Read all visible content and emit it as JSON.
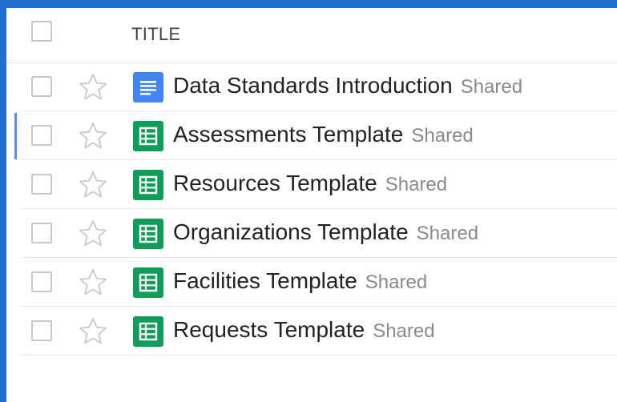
{
  "header": {
    "title_label": "TITLE"
  },
  "colors": {
    "docs_blue": "#4285f4",
    "sheets_green": "#0f9d58",
    "frame": "#1f6fcf"
  },
  "files": [
    {
      "name": "Data Standards Introduction",
      "status": "Shared",
      "type": "document",
      "icon": "google-docs-icon",
      "starred": false
    },
    {
      "name": "Assessments Template",
      "status": "Shared",
      "type": "spreadsheet",
      "icon": "google-sheets-icon",
      "starred": false
    },
    {
      "name": "Resources Template",
      "status": "Shared",
      "type": "spreadsheet",
      "icon": "google-sheets-icon",
      "starred": false
    },
    {
      "name": "Organizations Template",
      "status": "Shared",
      "type": "spreadsheet",
      "icon": "google-sheets-icon",
      "starred": false
    },
    {
      "name": "Facilities Template",
      "status": "Shared",
      "type": "spreadsheet",
      "icon": "google-sheets-icon",
      "starred": false
    },
    {
      "name": "Requests Template",
      "status": "Shared",
      "type": "spreadsheet",
      "icon": "google-sheets-icon",
      "starred": false
    }
  ]
}
